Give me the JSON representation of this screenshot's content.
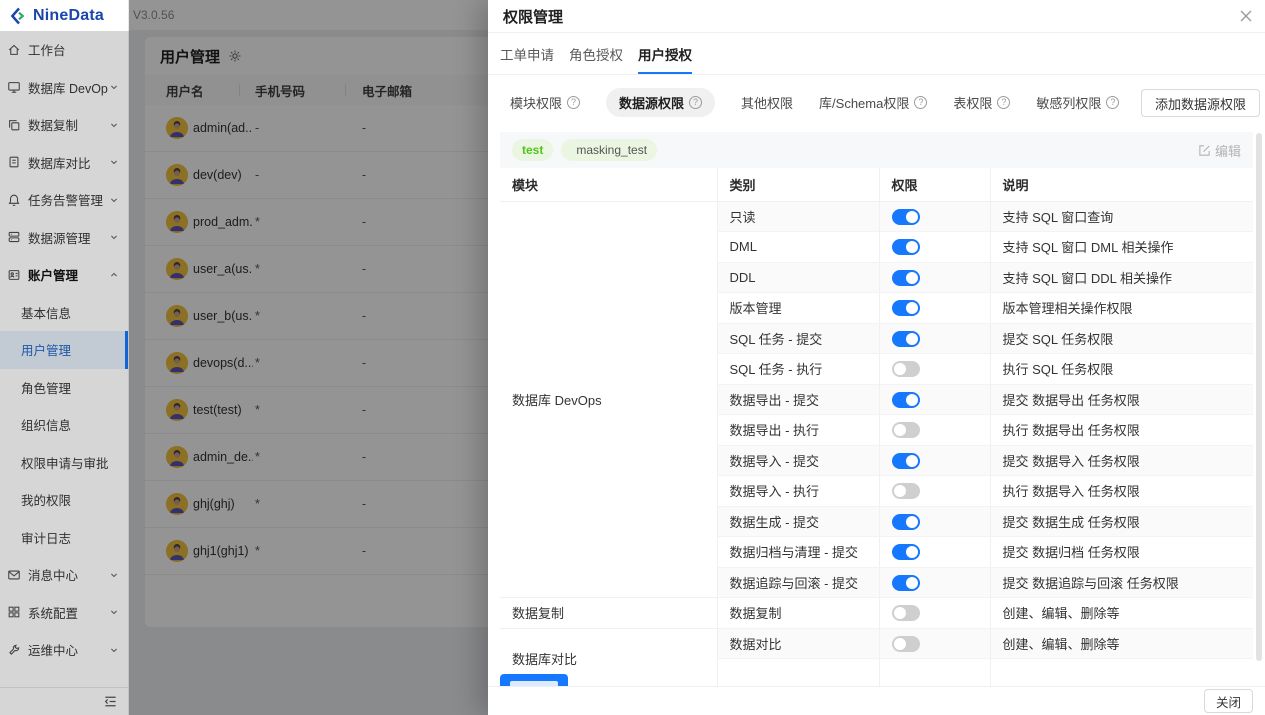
{
  "brand": {
    "name": "NineData",
    "version": "V3.0.56"
  },
  "colors": {
    "primary": "#1677ff",
    "toggle_off": "#cfcfcf",
    "tag_green_text": "#52c41a",
    "tag_green_bg": "#eaf6e2",
    "selected_menu": "#e7f1fd"
  },
  "sidebar": {
    "items": [
      {
        "label": "工作台",
        "icon": "home-icon",
        "level": 1
      },
      {
        "label": "数据库 DevOps",
        "icon": "devops-icon",
        "level": 1,
        "chevron": "down"
      },
      {
        "label": "数据复制",
        "icon": "replication-icon",
        "level": 1,
        "chevron": "down"
      },
      {
        "label": "数据库对比",
        "icon": "compare-icon",
        "level": 1,
        "chevron": "down"
      },
      {
        "label": "任务告警管理",
        "icon": "alert-icon",
        "level": 1,
        "chevron": "down"
      },
      {
        "label": "数据源管理",
        "icon": "datasource-icon",
        "level": 1,
        "chevron": "down"
      },
      {
        "label": "账户管理",
        "icon": "account-icon",
        "level": 1,
        "chevron": "up",
        "open": true
      },
      {
        "label": "基本信息",
        "level": 2
      },
      {
        "label": "用户管理",
        "level": 2,
        "selected": true
      },
      {
        "label": "角色管理",
        "level": 2
      },
      {
        "label": "组织信息",
        "level": 2
      },
      {
        "label": "权限申请与审批",
        "level": 2
      },
      {
        "label": "我的权限",
        "level": 2
      },
      {
        "label": "审计日志",
        "level": 2
      },
      {
        "label": "消息中心",
        "icon": "message-icon",
        "level": 1,
        "chevron": "down"
      },
      {
        "label": "系统配置",
        "icon": "settings-icon",
        "level": 1,
        "chevron": "down"
      },
      {
        "label": "运维中心",
        "icon": "ops-icon",
        "level": 1,
        "chevron": "down"
      }
    ]
  },
  "main": {
    "title": "用户管理",
    "table": {
      "headers": [
        "用户名",
        "手机号码",
        "电子邮箱"
      ],
      "rows": [
        {
          "name": "admin(ad...",
          "phone": "-",
          "email": "-"
        },
        {
          "name": "dev(dev)",
          "phone": "-",
          "email": "-"
        },
        {
          "name": "prod_adm...",
          "phone": "*",
          "email": "-"
        },
        {
          "name": "user_a(us...",
          "phone": "*",
          "email": "-"
        },
        {
          "name": "user_b(us...",
          "phone": "*",
          "email": "-"
        },
        {
          "name": "devops(d...",
          "phone": "*",
          "email": "-"
        },
        {
          "name": "test(test)",
          "phone": "*",
          "email": "-"
        },
        {
          "name": "admin_de...",
          "phone": "*",
          "email": "-"
        },
        {
          "name": "ghj(ghj)",
          "phone": "*",
          "email": "-"
        },
        {
          "name": "ghj1(ghj1)",
          "phone": "*",
          "email": "-"
        }
      ]
    }
  },
  "drawer": {
    "title": "权限管理",
    "tabs": [
      {
        "label": "工单申请",
        "active": false
      },
      {
        "label": "角色授权",
        "active": false
      },
      {
        "label": "用户授权",
        "active": true
      }
    ],
    "subtabs": [
      {
        "label": "模块权限",
        "help": true,
        "active": false
      },
      {
        "label": "数据源权限",
        "help": true,
        "active": true
      },
      {
        "label": "其他权限",
        "help": false,
        "active": false
      },
      {
        "label": "库/Schema权限",
        "help": true,
        "active": false
      },
      {
        "label": "表权限",
        "help": true,
        "active": false
      },
      {
        "label": "敏感列权限",
        "help": true,
        "active": false
      }
    ],
    "add_button": "添加数据源权限",
    "tags": [
      {
        "label": "test",
        "style": "green"
      },
      {
        "label": "masking_test",
        "icon": "masking-icon"
      }
    ],
    "edit_label": "编辑",
    "permission_table": {
      "headers": [
        "模块",
        "类别",
        "权限",
        "说明"
      ],
      "groups": [
        {
          "module": "数据库 DevOps",
          "rows": [
            {
              "category": "只读",
              "enabled": true,
              "desc": "支持 SQL 窗口查询"
            },
            {
              "category": "DML",
              "enabled": true,
              "desc": "支持 SQL 窗口 DML 相关操作"
            },
            {
              "category": "DDL",
              "enabled": true,
              "desc": "支持 SQL 窗口 DDL 相关操作"
            },
            {
              "category": "版本管理",
              "enabled": true,
              "desc": "版本管理相关操作权限"
            },
            {
              "category": "SQL 任务 - 提交",
              "enabled": true,
              "desc": "提交 SQL 任务权限"
            },
            {
              "category": "SQL 任务 - 执行",
              "enabled": false,
              "desc": "执行 SQL 任务权限"
            },
            {
              "category": "数据导出 - 提交",
              "enabled": true,
              "desc": "提交 数据导出 任务权限"
            },
            {
              "category": "数据导出 - 执行",
              "enabled": false,
              "desc": "执行 数据导出 任务权限"
            },
            {
              "category": "数据导入 - 提交",
              "enabled": true,
              "desc": "提交 数据导入 任务权限"
            },
            {
              "category": "数据导入 - 执行",
              "enabled": false,
              "desc": "执行 数据导入 任务权限"
            },
            {
              "category": "数据生成 - 提交",
              "enabled": true,
              "desc": "提交 数据生成 任务权限"
            },
            {
              "category": "数据归档与清理 - 提交",
              "enabled": true,
              "desc": "提交 数据归档 任务权限"
            },
            {
              "category": "数据追踪与回滚 - 提交",
              "enabled": true,
              "desc": "提交 数据追踪与回滚 任务权限"
            }
          ]
        },
        {
          "module": "数据复制",
          "rows": [
            {
              "category": "数据复制",
              "enabled": false,
              "desc": "创建、编辑、删除等"
            }
          ]
        },
        {
          "module": "数据库对比",
          "rows": [
            {
              "category": "数据对比",
              "enabled": false,
              "desc": "创建、编辑、删除等"
            },
            {
              "category": "",
              "enabled": null,
              "desc": ""
            }
          ]
        }
      ]
    },
    "close_button": "关闭"
  }
}
